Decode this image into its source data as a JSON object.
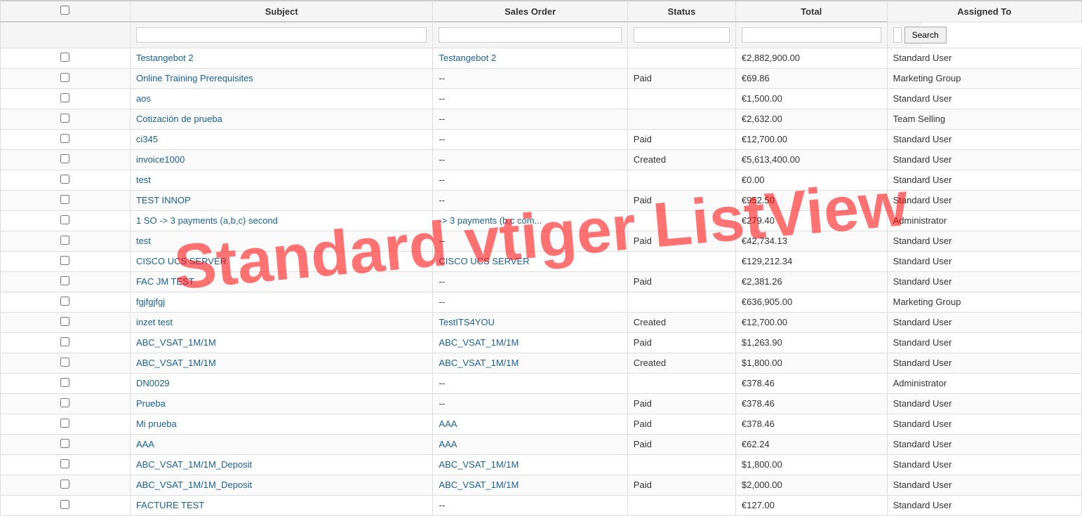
{
  "watermark": "Standard vtiger ListView",
  "columns": {
    "check": "",
    "subject": "Subject",
    "sales_order": "Sales Order",
    "status": "Status",
    "total": "Total",
    "assigned_to": "Assigned To"
  },
  "filters": {
    "subject_placeholder": "",
    "sales_order_placeholder": "",
    "status_placeholder": "",
    "total_placeholder": "",
    "assigned_placeholder": "",
    "search_label": "Search"
  },
  "rows": [
    {
      "subject": "Testangebot 2",
      "sales_order": "Testangebot 2",
      "status": "",
      "total": "€2,882,900.00",
      "assigned_to": "Standard User"
    },
    {
      "subject": "Online Training Prerequisites",
      "sales_order": "--",
      "status": "Paid",
      "total": "€69.86",
      "assigned_to": "Marketing Group"
    },
    {
      "subject": "aos",
      "sales_order": "--",
      "status": "",
      "total": "€1,500.00",
      "assigned_to": "Standard User"
    },
    {
      "subject": "Cotización de prueba",
      "sales_order": "--",
      "status": "",
      "total": "€2,632.00",
      "assigned_to": "Team Selling"
    },
    {
      "subject": "ci345",
      "sales_order": "--",
      "status": "Paid",
      "total": "€12,700.00",
      "assigned_to": "Standard User"
    },
    {
      "subject": "invoice1000",
      "sales_order": "--",
      "status": "Created",
      "total": "€5,613,400.00",
      "assigned_to": "Standard User"
    },
    {
      "subject": "test",
      "sales_order": "--",
      "status": "",
      "total": "€0.00",
      "assigned_to": "Standard User"
    },
    {
      "subject": "TEST INNOP",
      "sales_order": "--",
      "status": "Paid",
      "total": "€952.50",
      "assigned_to": "Standard User"
    },
    {
      "subject": "1 SO -> 3 payments (a,b,c) second",
      "sales_order": "-> 3 payments (b,c com...",
      "status": "",
      "total": "€279.40",
      "assigned_to": "Administrator"
    },
    {
      "subject": "test",
      "sales_order": "--",
      "status": "Paid",
      "total": "€42,734.13",
      "assigned_to": "Standard User"
    },
    {
      "subject": "CISCO UCS SERVER",
      "sales_order": "CISCO UCS SERVER",
      "status": "",
      "total": "€129,212.34",
      "assigned_to": "Standard User"
    },
    {
      "subject": "FAC JM TEST",
      "sales_order": "--",
      "status": "Paid",
      "total": "€2,381.26",
      "assigned_to": "Standard User"
    },
    {
      "subject": "fgjfgjfgj",
      "sales_order": "--",
      "status": "",
      "total": "€636,905.00",
      "assigned_to": "Marketing Group"
    },
    {
      "subject": "inzet test",
      "sales_order": "TestITS4YOU",
      "status": "Created",
      "total": "€12,700.00",
      "assigned_to": "Standard User"
    },
    {
      "subject": "ABC_VSAT_1M/1M",
      "sales_order": "ABC_VSAT_1M/1M",
      "status": "Paid",
      "total": "$1,263.90",
      "assigned_to": "Standard User"
    },
    {
      "subject": "ABC_VSAT_1M/1M",
      "sales_order": "ABC_VSAT_1M/1M",
      "status": "Created",
      "total": "$1,800.00",
      "assigned_to": "Standard User"
    },
    {
      "subject": "DN0029",
      "sales_order": "--",
      "status": "",
      "total": "€378.46",
      "assigned_to": "Administrator"
    },
    {
      "subject": "Prueba",
      "sales_order": "--",
      "status": "Paid",
      "total": "€378.46",
      "assigned_to": "Standard User"
    },
    {
      "subject": "Mi prueba",
      "sales_order": "AAA",
      "status": "Paid",
      "total": "€378.46",
      "assigned_to": "Standard User"
    },
    {
      "subject": "AAA",
      "sales_order": "AAA",
      "status": "Paid",
      "total": "€62.24",
      "assigned_to": "Standard User"
    },
    {
      "subject": "ABC_VSAT_1M/1M_Deposit",
      "sales_order": "ABC_VSAT_1M/1M",
      "status": "",
      "total": "$1,800.00",
      "assigned_to": "Standard User"
    },
    {
      "subject": "ABC_VSAT_1M/1M_Deposit",
      "sales_order": "ABC_VSAT_1M/1M",
      "status": "Paid",
      "total": "$2,000.00",
      "assigned_to": "Standard User"
    },
    {
      "subject": "FACTURE TEST",
      "sales_order": "--",
      "status": "",
      "total": "€127.00",
      "assigned_to": "Standard User"
    }
  ]
}
